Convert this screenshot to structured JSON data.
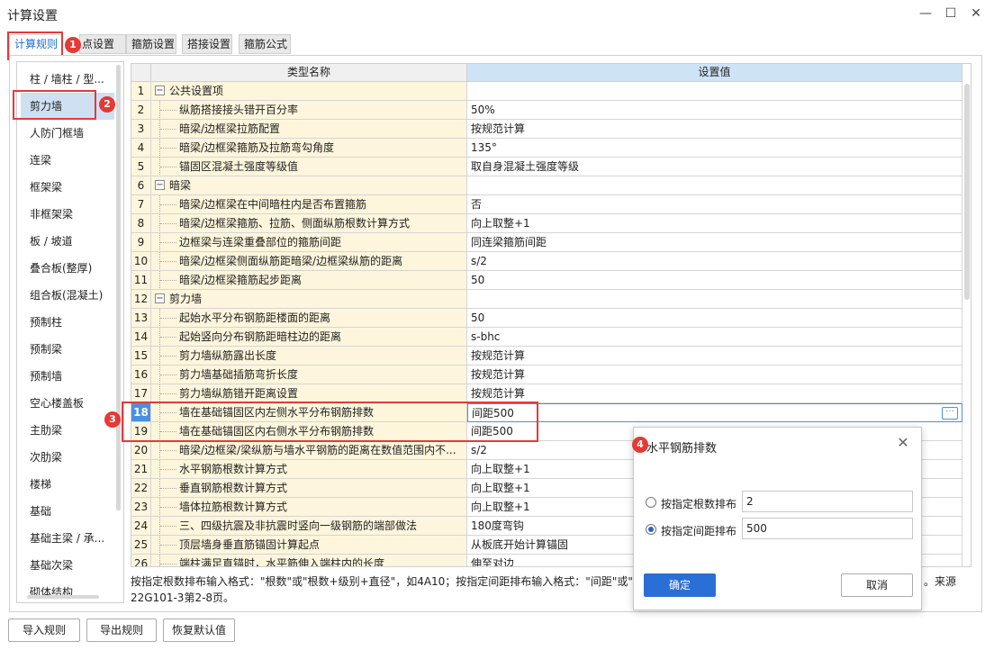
{
  "window": {
    "title": "计算设置",
    "minimize": "—",
    "maximize": "☐",
    "close": "✕"
  },
  "tabs": [
    "计算规则",
    "点设置",
    "箍筋设置",
    "搭接设置",
    "箍筋公式"
  ],
  "badges": [
    "1",
    "2",
    "3",
    "4"
  ],
  "sidebar": {
    "items": [
      "柱 / 墙柱 / 型...",
      "剪力墙",
      "人防门框墙",
      "连梁",
      "框架梁",
      "非框架梁",
      "板 / 坡道",
      "叠合板(整厚)",
      "组合板(混凝土)",
      "预制柱",
      "预制梁",
      "预制墙",
      "空心楼盖板",
      "主肋梁",
      "次肋梁",
      "楼梯",
      "基础",
      "基础主梁 / 承...",
      "基础次梁",
      "砌体结构"
    ]
  },
  "grid": {
    "headers": [
      "类型名称",
      "设置值"
    ],
    "rows": [
      {
        "no": "1",
        "name": "公共设置项",
        "value": "",
        "group": true
      },
      {
        "no": "2",
        "name": "纵筋搭接接头错开百分率",
        "value": "50%"
      },
      {
        "no": "3",
        "name": "暗梁/边框梁拉筋配置",
        "value": "按规范计算"
      },
      {
        "no": "4",
        "name": "暗梁/边框梁箍筋及拉筋弯勾角度",
        "value": "135°"
      },
      {
        "no": "5",
        "name": "锚固区混凝土强度等级值",
        "value": "取自身混凝土强度等级"
      },
      {
        "no": "6",
        "name": "暗梁",
        "value": "",
        "group": true
      },
      {
        "no": "7",
        "name": "暗梁/边框梁在中间暗柱内是否布置箍筋",
        "value": "否"
      },
      {
        "no": "8",
        "name": "暗梁/边框梁箍筋、拉筋、侧面纵筋根数计算方式",
        "value": "向上取整+1"
      },
      {
        "no": "9",
        "name": "边框梁与连梁重叠部位的箍筋间距",
        "value": "同连梁箍筋间距"
      },
      {
        "no": "10",
        "name": "暗梁/边框梁侧面纵筋距暗梁/边框梁纵筋的距离",
        "value": "s/2"
      },
      {
        "no": "11",
        "name": "暗梁/边框梁箍筋起步距离",
        "value": "50"
      },
      {
        "no": "12",
        "name": "剪力墙",
        "value": "",
        "group": true
      },
      {
        "no": "13",
        "name": "起始水平分布钢筋距楼面的距离",
        "value": "50"
      },
      {
        "no": "14",
        "name": "起始竖向分布钢筋距暗柱边的距离",
        "value": "s-bhc"
      },
      {
        "no": "15",
        "name": "剪力墙纵筋露出长度",
        "value": "按规范计算"
      },
      {
        "no": "16",
        "name": "剪力墙基础插筋弯折长度",
        "value": "按规范计算"
      },
      {
        "no": "17",
        "name": "剪力墙纵筋错开距离设置",
        "value": "按规范计算"
      },
      {
        "no": "18",
        "name": "墙在基础锚固区内左侧水平分布钢筋排数",
        "value": "间距500",
        "focus": true
      },
      {
        "no": "19",
        "name": "墙在基础锚固区内右侧水平分布钢筋排数",
        "value": "间距500"
      },
      {
        "no": "20",
        "name": "暗梁/边框梁/梁纵筋与墙水平钢筋的距离在数值范围内不...",
        "value": "s/2"
      },
      {
        "no": "21",
        "name": "水平钢筋根数计算方式",
        "value": "向上取整+1"
      },
      {
        "no": "22",
        "name": "垂直钢筋根数计算方式",
        "value": "向上取整+1"
      },
      {
        "no": "23",
        "name": "墙体拉筋根数计算方式",
        "value": "向上取整+1"
      },
      {
        "no": "24",
        "name": "三、四级抗震及非抗震时竖向一级钢筋的端部做法",
        "value": "180度弯钩"
      },
      {
        "no": "25",
        "name": "顶层墙身垂直筋锚固计算起点",
        "value": "从板底开始计算锚固"
      },
      {
        "no": "26",
        "name": "端柱满足直锚时，水平筋伸入端柱内的长度",
        "value": "伸至对边"
      }
    ],
    "ellipsis": "···"
  },
  "hint": {
    "line1": "按指定根数排布输入格式：\"根数\"或\"根数+级别+直径\"，如4A10；按指定间距排布输入格式：\"间距\"或\"级",
    "line1_tail": "。来源",
    "line2": "22G101-3第2-8页。"
  },
  "bottom_buttons": [
    "导入规则",
    "导出规则",
    "恢复默认值"
  ],
  "dialog": {
    "title": "水平钢筋排数",
    "close": "✕",
    "option_count_label": "按指定根数排布",
    "option_count_value": "2",
    "option_spacing_label": "按指定间距排布",
    "option_spacing_value": "500",
    "selected": "spacing",
    "ok": "确定",
    "cancel": "取消"
  },
  "colors": {
    "accent": "#2a6fd6",
    "highlight": "#e23b3b",
    "name_cell_bg": "#fdf6dc",
    "header_value_bg": "#cfe3f7"
  }
}
